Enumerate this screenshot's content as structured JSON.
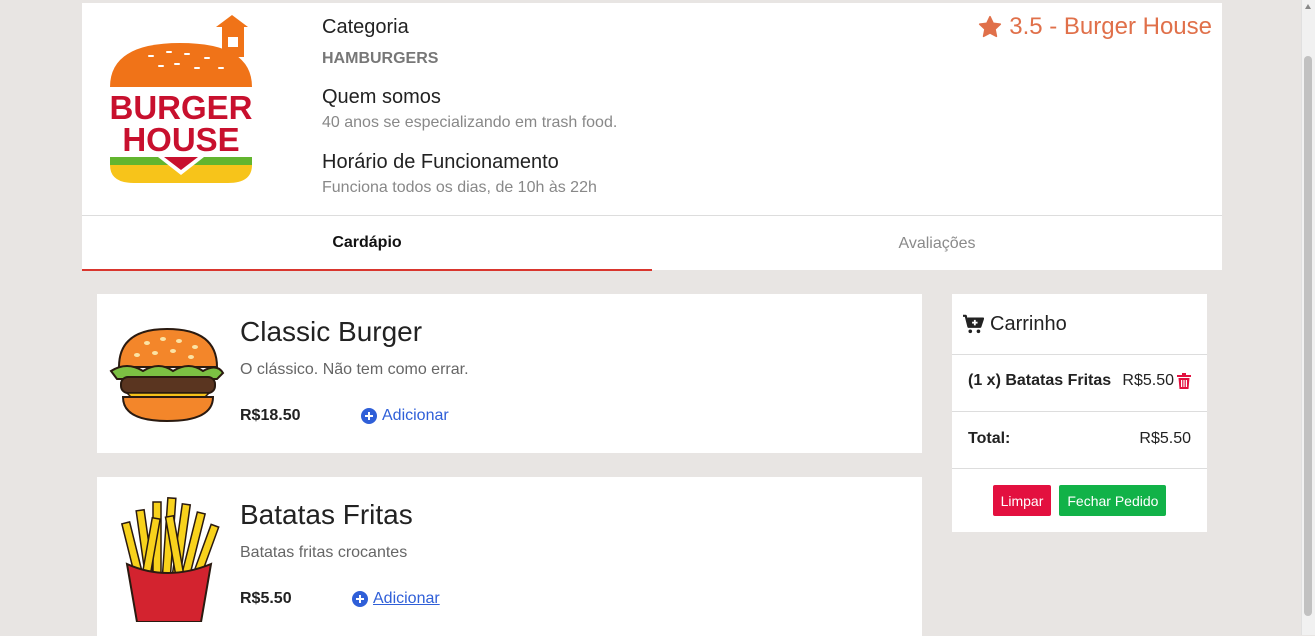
{
  "restaurant": {
    "logo_text_line1": "BURGER",
    "logo_text_line2": "HOUSE",
    "category_title": "Categoria",
    "category_value": "HAMBURGERS",
    "about_title": "Quem somos",
    "about_text": "40 anos se especializando em trash food.",
    "hours_title": "Horário de Funcionamento",
    "hours_text": "Funciona todos os dias, de 10h às 22h",
    "rating_text": "3.5 - Burger House",
    "rating_icon": "star-icon"
  },
  "tabs": [
    {
      "label": "Cardápio",
      "active": true
    },
    {
      "label": "Avaliações",
      "active": false
    }
  ],
  "products": [
    {
      "name": "Classic Burger",
      "description": "O clássico. Não tem como errar.",
      "price": "R$18.50",
      "add_label": "Adicionar",
      "image": "burger-image"
    },
    {
      "name": "Batatas Fritas",
      "description": "Batatas fritas crocantes",
      "price": "R$5.50",
      "add_label": " Adicionar",
      "image": "fries-image"
    }
  ],
  "cart": {
    "title": "Carrinho",
    "icon": "cart-plus-icon",
    "items": [
      {
        "label": "(1 x) Batatas Fritas",
        "price": "R$5.50"
      }
    ],
    "total_label": "Total:",
    "total_value": "R$5.50",
    "clear_label": "Limpar",
    "checkout_label": "Fechar Pedido"
  },
  "colors": {
    "accent": "#e0704a",
    "tab_underline": "#d9362e",
    "link": "#2f5fd8",
    "clear_button": "#e3103f",
    "checkout_button": "#11b248",
    "trash": "#e3103f"
  }
}
